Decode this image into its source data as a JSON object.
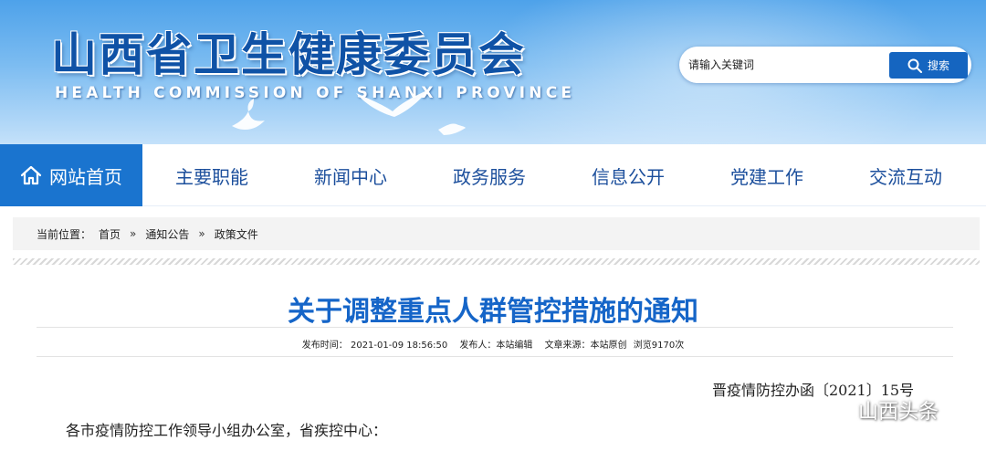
{
  "header": {
    "site_title": "山西省卫生健康委员会",
    "site_subtitle": "HEALTH COMMISSION OF SHANXI PROVINCE",
    "search": {
      "placeholder": "请输入关键词",
      "button_label": "搜索",
      "icon": "search-icon"
    }
  },
  "nav": {
    "items": [
      {
        "label": "网站首页",
        "icon": "home-icon",
        "active": true
      },
      {
        "label": "主要职能"
      },
      {
        "label": "新闻中心"
      },
      {
        "label": "政务服务"
      },
      {
        "label": "信息公开"
      },
      {
        "label": "党建工作"
      },
      {
        "label": "交流互动"
      }
    ]
  },
  "breadcrumb": {
    "prefix": "当前位置：",
    "items": [
      "首页",
      "通知公告",
      "政策文件"
    ],
    "separator": "»"
  },
  "article": {
    "title": "关于调整重点人群管控措施的通知",
    "meta": {
      "publish_time": "发布时间：  2021-01-09 18:56:50",
      "publisher": "发布人：本站编辑",
      "source": "文章来源：本站原创",
      "views": "浏览9170次"
    },
    "doc_number": "晋疫情防控办函〔2021〕15号",
    "salutation": "各市疫情防控工作领导小组办公室，省疾控中心："
  },
  "watermark": {
    "text": "山西头条",
    "icon": "wechat-icon"
  },
  "colors": {
    "brand_blue": "#1a74cf",
    "nav_text": "#1c4f9c",
    "title_blue": "#1565c8"
  }
}
